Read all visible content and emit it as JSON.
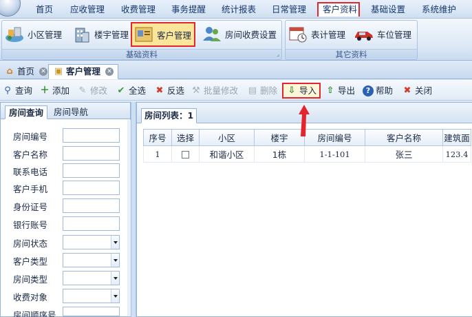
{
  "menu": {
    "items": [
      "首页",
      "应收管理",
      "收费管理",
      "事务提醒",
      "统计报表",
      "日常管理",
      "客户资料",
      "基础设置",
      "系统维护"
    ],
    "active_index": 6
  },
  "ribbon": {
    "groups": [
      {
        "label": "基础资料",
        "buttons": [
          "小区管理",
          "楼宇管理",
          "客户管理",
          "房间收费设置"
        ]
      },
      {
        "label": "其它资料",
        "buttons": [
          "表计管理",
          "车位管理"
        ]
      }
    ],
    "highlighted_button": "客户管理"
  },
  "doc_tabs": [
    "首页",
    "客户管理"
  ],
  "toolbar": {
    "buttons": [
      "查询",
      "添加",
      "修改",
      "全选",
      "反选",
      "批量修改",
      "删除",
      "导入",
      "导出",
      "帮助",
      "关闭"
    ],
    "disabled": [
      "修改",
      "批量修改",
      "删除"
    ],
    "highlighted_button": "导入"
  },
  "left_panel": {
    "tabs": [
      "房间查询",
      "房间导航"
    ],
    "fields": [
      "房间编号",
      "客户名称",
      "联系电话",
      "客户手机",
      "身份证号",
      "银行账号"
    ],
    "selects": [
      "房间状态",
      "客户类型",
      "房间类型",
      "收费对象",
      "房间顺序号"
    ]
  },
  "right_panel": {
    "tab_label": "房间列表：1",
    "columns": [
      "序号",
      "选择",
      "小区",
      "楼宇",
      "房间编号",
      "客户名称",
      "建筑面"
    ],
    "rows": [
      {
        "no": "1",
        "checked": false,
        "community": "和谐小区",
        "building": "1栋",
        "room": "1-1-101",
        "customer": "张三",
        "area": "123.4"
      }
    ]
  },
  "colors": {
    "highlight": "#e3262e",
    "accent": "#15366b"
  }
}
